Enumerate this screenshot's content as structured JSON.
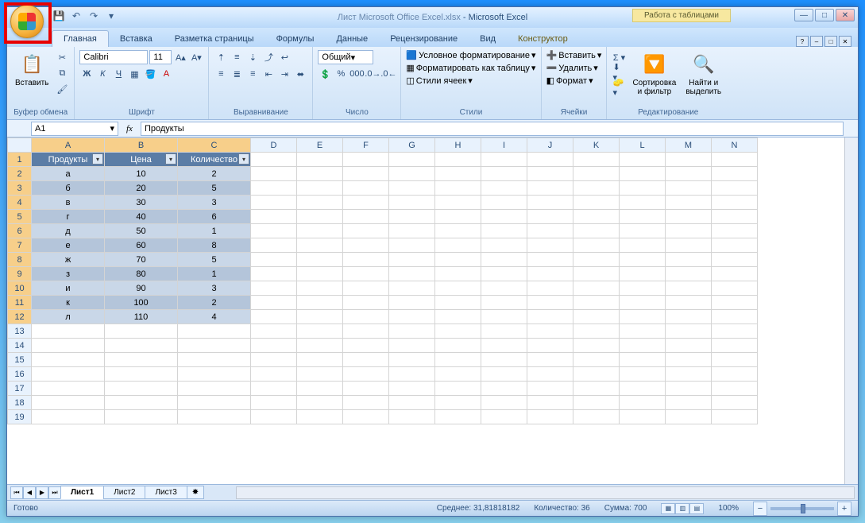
{
  "title": {
    "doc": "Лист Microsoft Office Excel.xlsx",
    "app": "Microsoft Excel"
  },
  "tabletools": "Работа с таблицами",
  "tabs": {
    "home": "Главная",
    "insert": "Вставка",
    "layout": "Разметка страницы",
    "formulas": "Формулы",
    "data": "Данные",
    "review": "Рецензирование",
    "view": "Вид",
    "design": "Конструктор"
  },
  "groups": {
    "clipboard": "Буфер обмена",
    "font": "Шрифт",
    "align": "Выравнивание",
    "number": "Число",
    "styles": "Стили",
    "cells": "Ячейки",
    "editing": "Редактирование"
  },
  "clipboard": {
    "paste": "Вставить"
  },
  "font": {
    "name": "Calibri",
    "size": "11"
  },
  "number": {
    "format": "Общий"
  },
  "styles": {
    "cond": "Условное форматирование",
    "astable": "Форматировать как таблицу",
    "cellstyles": "Стили ячеек"
  },
  "cells": {
    "insert": "Вставить",
    "delete": "Удалить",
    "format": "Формат"
  },
  "editing": {
    "sort": "Сортировка\nи фильтр",
    "find": "Найти и\nвыделить"
  },
  "namebox": "A1",
  "formula": "Продукты",
  "cols": [
    "A",
    "B",
    "C",
    "D",
    "E",
    "F",
    "G",
    "H",
    "I",
    "J",
    "K",
    "L",
    "M",
    "N"
  ],
  "headers": {
    "c1": "Продукты",
    "c2": "Цена",
    "c3": "Количество"
  },
  "rows": [
    {
      "p": "а",
      "c": "10",
      "q": "2"
    },
    {
      "p": "б",
      "c": "20",
      "q": "5"
    },
    {
      "p": "в",
      "c": "30",
      "q": "3"
    },
    {
      "p": "г",
      "c": "40",
      "q": "6"
    },
    {
      "p": "д",
      "c": "50",
      "q": "1"
    },
    {
      "p": "е",
      "c": "60",
      "q": "8"
    },
    {
      "p": "ж",
      "c": "70",
      "q": "5"
    },
    {
      "p": "з",
      "c": "80",
      "q": "1"
    },
    {
      "p": "и",
      "c": "90",
      "q": "3"
    },
    {
      "p": "к",
      "c": "100",
      "q": "2"
    },
    {
      "p": "л",
      "c": "110",
      "q": "4"
    }
  ],
  "sheets": {
    "s1": "Лист1",
    "s2": "Лист2",
    "s3": "Лист3"
  },
  "status": {
    "ready": "Готово",
    "avg": "Среднее: 31,81818182",
    "count": "Количество: 36",
    "sum": "Сумма: 700",
    "zoom": "100%"
  }
}
